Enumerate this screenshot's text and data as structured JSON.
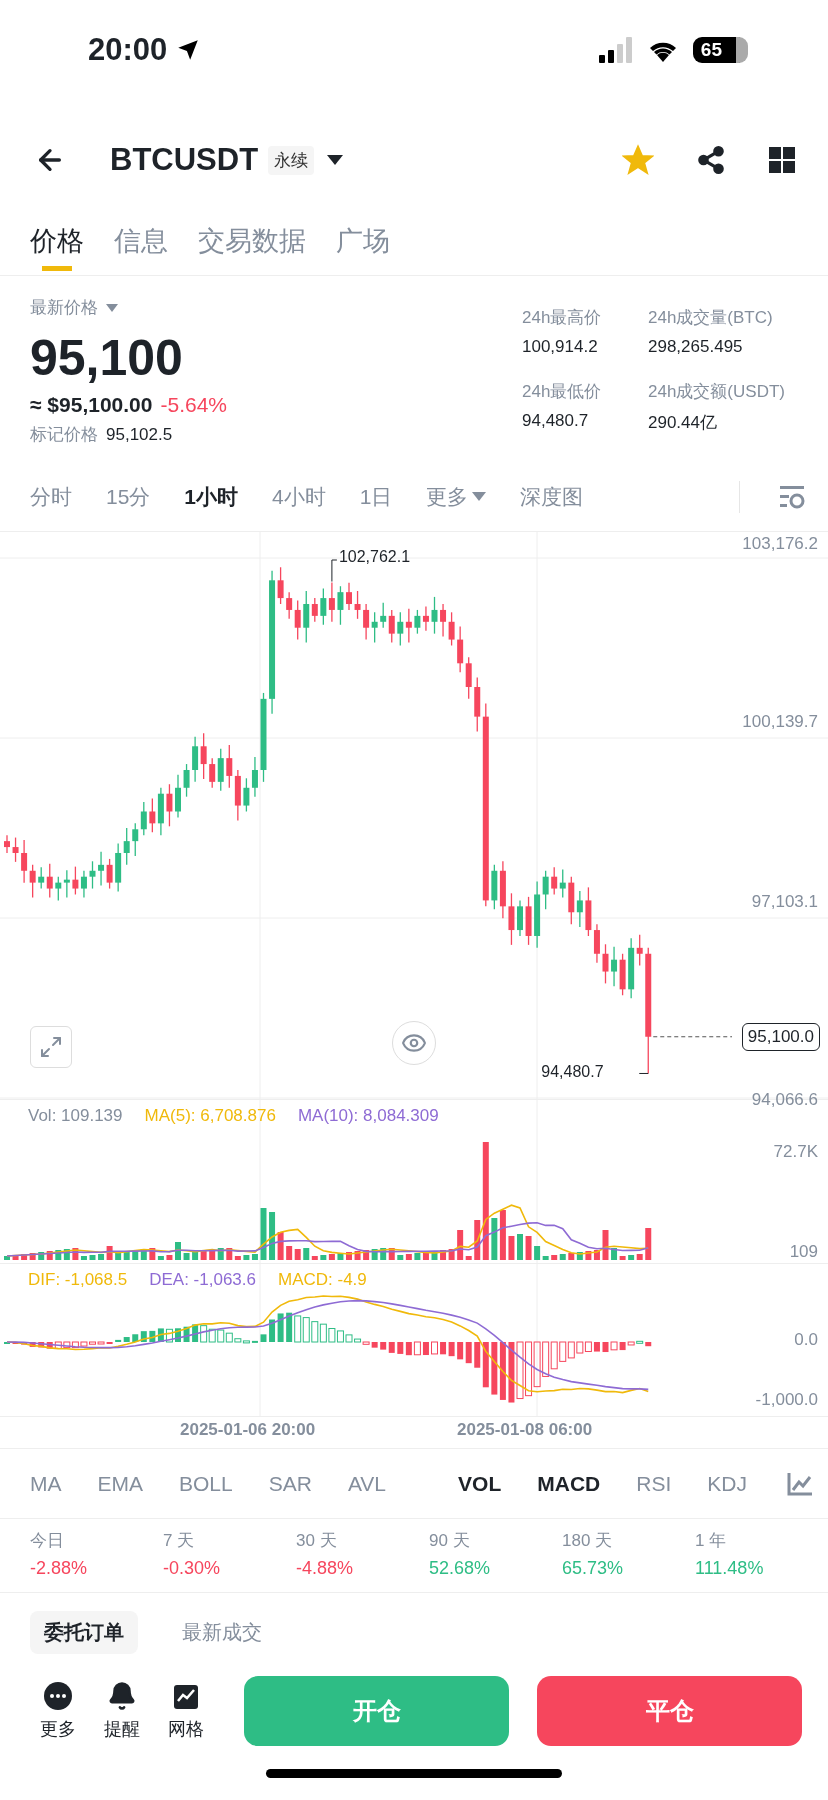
{
  "status_bar": {
    "time": "20:00",
    "battery": "65"
  },
  "header": {
    "symbol": "BTCUSDT",
    "badge": "永续",
    "favorite": true
  },
  "tabs": [
    {
      "label": "价格",
      "selected": true
    },
    {
      "label": "信息",
      "selected": false
    },
    {
      "label": "交易数据",
      "selected": false
    },
    {
      "label": "广场",
      "selected": false
    }
  ],
  "price": {
    "label": "最新价格",
    "last": "95,100",
    "usd": "≈ $95,100.00",
    "change": "-5.64%",
    "mark_label": "标记价格",
    "mark": "95,102.5"
  },
  "stats": [
    {
      "label": "24h最高价",
      "value": "100,914.2"
    },
    {
      "label": "24h成交量(BTC)",
      "value": "298,265.495"
    },
    {
      "label": "24h最低价",
      "value": "94,480.7"
    },
    {
      "label": "24h成交额(USDT)",
      "value": "290.44亿"
    }
  ],
  "intervals": [
    {
      "label": "分时",
      "selected": false
    },
    {
      "label": "15分",
      "selected": false
    },
    {
      "label": "1小时",
      "selected": true
    },
    {
      "label": "4小时",
      "selected": false
    },
    {
      "label": "1日",
      "selected": false
    }
  ],
  "more_label": "更多",
  "depth_label": "深度图",
  "chart": {
    "price_axis": [
      "103,176.2",
      "100,139.7",
      "97,103.1",
      "94,066.6"
    ],
    "high_label": "102,762.1",
    "low_label": "94,480.7",
    "last_price": "95,100.0"
  },
  "volume": {
    "vol": "Vol: 109.139",
    "ma5": "MA(5): 6,708.876",
    "ma10": "MA(10): 8,084.309",
    "axis": [
      "72.7K",
      "109"
    ]
  },
  "macd": {
    "dif": "DIF: -1,068.5",
    "dea": "DEA: -1,063.6",
    "macd": "MACD: -4.9",
    "axis": [
      "0.0",
      "-1,000.0"
    ]
  },
  "dates": [
    "2025-01-06 20:00",
    "2025-01-08 06:00"
  ],
  "main_indicators": [
    {
      "label": "MA",
      "selected": false
    },
    {
      "label": "EMA",
      "selected": false
    },
    {
      "label": "BOLL",
      "selected": false
    },
    {
      "label": "SAR",
      "selected": false
    },
    {
      "label": "AVL",
      "selected": false
    }
  ],
  "sub_indicators": [
    {
      "label": "VOL",
      "selected": true
    },
    {
      "label": "MACD",
      "selected": true
    },
    {
      "label": "RSI",
      "selected": false
    },
    {
      "label": "KDJ",
      "selected": false
    }
  ],
  "performance": [
    {
      "period": "今日",
      "change": "-2.88%",
      "color": "#f6465d"
    },
    {
      "period": "7 天",
      "change": "-0.30%",
      "color": "#f6465d"
    },
    {
      "period": "30 天",
      "change": "-4.88%",
      "color": "#f6465d"
    },
    {
      "period": "90 天",
      "change": "52.68%",
      "color": "#2ebd85"
    },
    {
      "period": "180 天",
      "change": "65.73%",
      "color": "#2ebd85"
    },
    {
      "period": "1 年",
      "change": "111.48%",
      "color": "#2ebd85"
    }
  ],
  "order_tabs": [
    {
      "label": "委托订单",
      "selected": true
    },
    {
      "label": "最新成交",
      "selected": false
    }
  ],
  "actions": [
    {
      "label": "更多",
      "kind": "more"
    },
    {
      "label": "提醒",
      "kind": "bell"
    },
    {
      "label": "网格",
      "kind": "grid"
    }
  ],
  "buttons": [
    {
      "label": "开仓",
      "kind": "open"
    },
    {
      "label": "平仓",
      "kind": "close"
    }
  ]
}
